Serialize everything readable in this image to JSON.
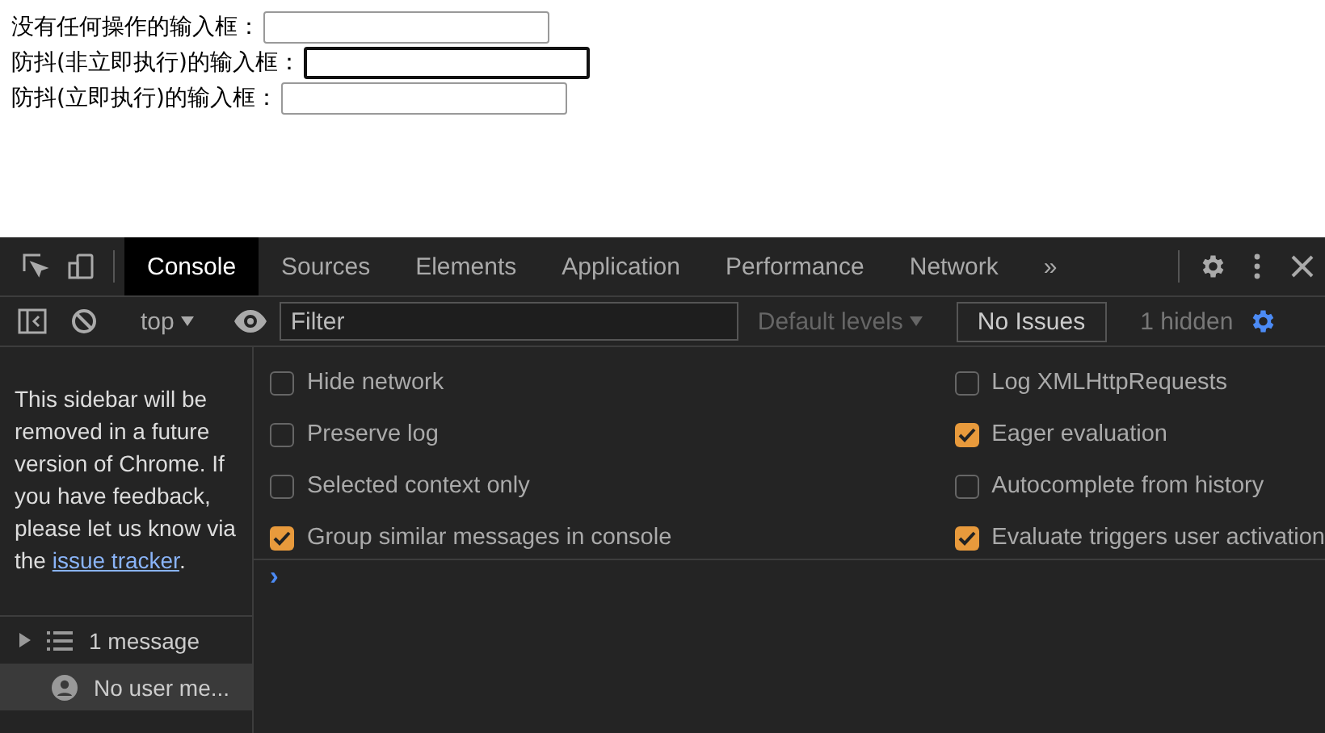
{
  "page": {
    "fields": [
      {
        "label": "没有任何操作的输入框：",
        "focused": false
      },
      {
        "label": "防抖(非立即执行)的输入框：",
        "focused": true
      },
      {
        "label": "防抖(立即执行)的输入框：",
        "focused": false
      }
    ]
  },
  "devtools": {
    "tabs": [
      {
        "label": "Console",
        "selected": true
      },
      {
        "label": "Sources",
        "selected": false
      },
      {
        "label": "Elements",
        "selected": false
      },
      {
        "label": "Application",
        "selected": false
      },
      {
        "label": "Performance",
        "selected": false
      },
      {
        "label": "Network",
        "selected": false
      }
    ],
    "more_tabs": "»",
    "toolbar": {
      "context": "top",
      "filter_placeholder": "Filter",
      "levels": "Default levels",
      "issues": "No Issues",
      "hidden": "1 hidden"
    },
    "sidebar": {
      "notice": "This sidebar will be removed in a future version of Chrome. If you have feedback, please let us know via the ",
      "link": "issue tracker",
      "notice_end": ".",
      "items": [
        {
          "label": "1 message",
          "kind": "group",
          "selected": false
        },
        {
          "label": "No user me...",
          "kind": "user",
          "selected": true
        }
      ]
    },
    "settings": [
      [
        {
          "label": "Hide network",
          "checked": false
        },
        {
          "label": "Preserve log",
          "checked": false
        },
        {
          "label": "Selected context only",
          "checked": false
        },
        {
          "label": "Group similar messages in console",
          "checked": true
        }
      ],
      [
        {
          "label": "Log XMLHttpRequests",
          "checked": false
        },
        {
          "label": "Eager evaluation",
          "checked": true
        },
        {
          "label": "Autocomplete from history",
          "checked": false
        },
        {
          "label": "Evaluate triggers user activation",
          "checked": true
        }
      ]
    ],
    "prompt": "›"
  }
}
